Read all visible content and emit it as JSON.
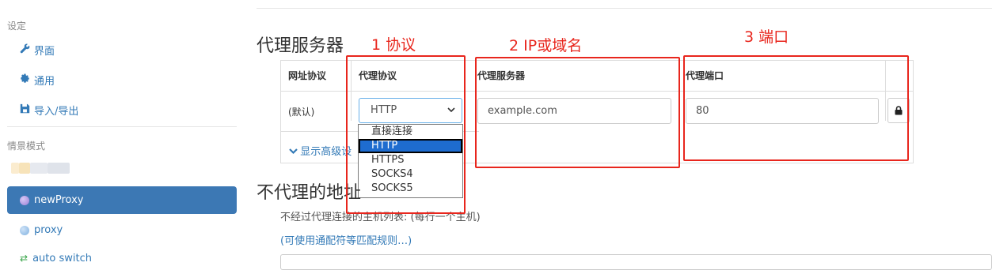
{
  "sidebar": {
    "settings_header": "设定",
    "items": [
      {
        "label": "界面",
        "icon": "wrench-icon"
      },
      {
        "label": "通用",
        "icon": "gear-icon"
      },
      {
        "label": "导入/导出",
        "icon": "floppy-icon"
      }
    ],
    "profiles_header": "情景模式",
    "profiles": [
      {
        "label": "newProxy",
        "icon": "globe-icon",
        "active": true
      },
      {
        "label": "proxy",
        "icon": "globe-icon",
        "active": false
      },
      {
        "label": "auto switch",
        "icon": "switch-icon",
        "active": false
      }
    ]
  },
  "main": {
    "proxy_servers_title": "代理服务器",
    "table": {
      "headers": [
        "网址协议",
        "代理协议",
        "代理服务器",
        "代理端口"
      ],
      "row": {
        "url_scheme": "(默认)",
        "protocol_value": "HTTP",
        "server_placeholder": "example.com",
        "port_value": "80"
      },
      "advanced_link": "显示高级设"
    },
    "protocol_options": [
      "直接连接",
      "HTTP",
      "HTTPS",
      "SOCKS4",
      "SOCKS5"
    ],
    "selected_protocol": "HTTP",
    "bypass_title": "不代理的地址",
    "bypass_desc": "不经过代理连接的主机列表: (每行一个主机)",
    "bypass_hint": "(可使用通配符等匹配规则…)"
  },
  "annotations": [
    {
      "label": "1 协议"
    },
    {
      "label": "2 IP或域名"
    },
    {
      "label": "3 端口"
    }
  ],
  "colors": {
    "accent": "#337ab7",
    "active_bg": "#3c78b4",
    "annotation_red": "#e8261d",
    "dropdown_selected": "#1e6ccf"
  }
}
